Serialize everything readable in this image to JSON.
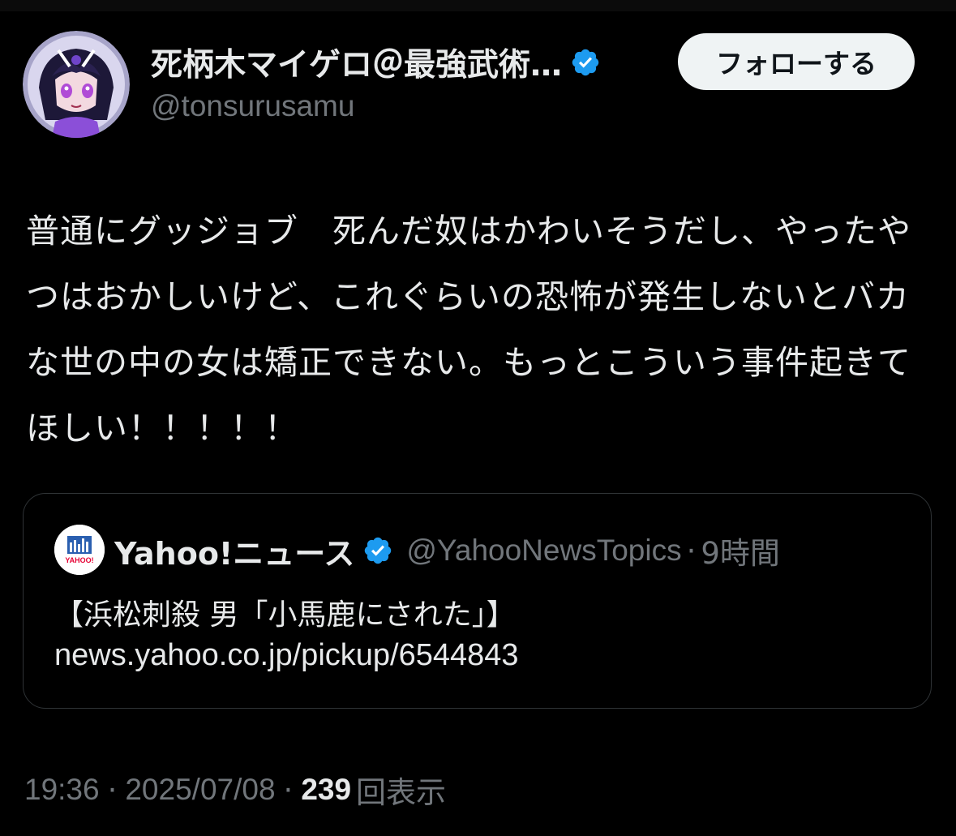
{
  "tweet": {
    "author": {
      "display_name": "死柄木マイゲロ＠最強武術…",
      "handle": "@tonsurusamu",
      "verified": true
    },
    "follow_button_label": "フォローする",
    "text": "普通にグッジョブ　死んだ奴はかわいそうだし、やったやつはおかしいけど、これぐらいの恐怖が発生しないとバカな世の中の女は矯正できない。もっとこういう事件起きてほしい！！！！！",
    "quoted": {
      "display_name": "Yahoo!ニュース",
      "handle": "@YahooNewsTopics",
      "separator": "·",
      "time": "9時間",
      "title": "【浜松刺殺 男「小馬鹿にされた」】",
      "link": "news.yahoo.co.jp/pickup/6544843",
      "logo_text": "YAHOO!"
    },
    "meta": {
      "time": "19:36",
      "separator": "·",
      "date": "2025/07/08",
      "views": "239",
      "views_label": "回表示"
    }
  },
  "colors": {
    "background": "#000000",
    "text_primary": "#e7e9ea",
    "text_secondary": "#71767b",
    "verified_blue": "#1d9bf0",
    "border": "#2f3336",
    "follow_button_bg": "#eff3f4"
  }
}
